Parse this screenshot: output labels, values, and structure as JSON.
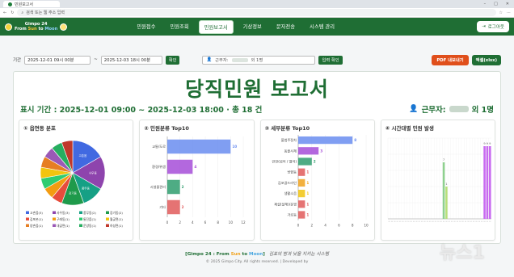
{
  "browser": {
    "tab_title": "민원보고서",
    "url_placeholder": "검색 또는 웹 주소 입력"
  },
  "app": {
    "logo_title": "Gimpo 24",
    "logo_sub_from": "From ",
    "logo_sub_sun": "Sun",
    "logo_sub_to": " to ",
    "logo_sub_moon": "Moon",
    "nav": [
      "민원접수",
      "민원조회",
      "민원보고서",
      "기상정보",
      "문자전송",
      "시스템 관리"
    ],
    "active_nav": 2,
    "logout": "로그아웃"
  },
  "filters": {
    "label": "기간",
    "start": "2025-12-01 09시 00분",
    "sep": "~",
    "end": "2025-12-03 18시 00분",
    "confirm": "확인",
    "worker_label": "근무자:",
    "worker_value": "외 1명",
    "worker_confirm": "입력 확인",
    "pdf": "PDF 내보내기",
    "excel": "엑셀(xlsx)"
  },
  "report": {
    "title": "당직민원 보고서",
    "period": "표시 기간 : 2025-12-01 09:00 ~ 2025-12-03 18:00 · 총 18 건",
    "worker_prefix": "근무자:",
    "worker_suffix": "외 1명"
  },
  "panels": {
    "p1": "① 읍면동 분포",
    "p2": "② 민원분류 Top10",
    "p3": "③ 세부분류 Top10",
    "p4": "④ 시간대별 민원 발생"
  },
  "chart_data": [
    {
      "type": "pie",
      "series_values": [
        3,
        3,
        2,
        2,
        1,
        1,
        1,
        1,
        1,
        1,
        1,
        1
      ],
      "colors": [
        "#4169e1",
        "#8e44ad",
        "#16a085",
        "#1f9a4b",
        "#e74c3c",
        "#f39c12",
        "#2ecc71",
        "#f1c40f",
        "#e67e22",
        "#9b59b6",
        "#27ae60",
        "#c0392b"
      ],
      "slice_labels": [
        "고촌읍",
        "사우동",
        "풍무동",
        "장기동",
        "",
        "",
        "",
        "",
        "",
        "",
        "",
        ""
      ],
      "legend": [
        "고촌읍(3)",
        "사우동(3)",
        "풍무동(2)",
        "장기동(2)",
        "김포본(1)",
        "구래동(1)",
        "통진읍(1)",
        "월곶면(1)",
        "양촌읍(1)",
        "대곶면(1)",
        "운양동(1)",
        "하성면(1)"
      ]
    },
    {
      "type": "bar",
      "orientation": "horizontal",
      "categories": [
        "교통/도로",
        "환경/위생",
        "시설물관리",
        "기타"
      ],
      "values": [
        10,
        4,
        2,
        2
      ],
      "colors": [
        "#6a8df0",
        "#a64dd8",
        "#2f9e6e",
        "#e05b5b"
      ],
      "xlim": [
        0,
        12
      ],
      "xticks": [
        0,
        2,
        4,
        6,
        8,
        10,
        12
      ]
    },
    {
      "type": "bar",
      "orientation": "horizontal",
      "categories": [
        "불법주정차",
        "동물사체",
        "안전(넘어 / 떨어)",
        "방향등",
        "김포골드라인",
        "생활소음",
        "제설(설해)/운영",
        "가로등"
      ],
      "values": [
        8,
        3,
        2,
        1,
        1,
        1,
        1,
        1
      ],
      "colors": [
        "#6a8df0",
        "#a64dd8",
        "#2f9e6e",
        "#e05b5b",
        "#f0a21c",
        "#f1c40f",
        "#e05b5b",
        "#e05b5b"
      ],
      "xlim": [
        0,
        10
      ],
      "xticks": [
        0,
        2,
        4,
        6,
        8,
        10
      ]
    },
    {
      "type": "bar",
      "categories_count": 38,
      "values": [
        0,
        0,
        0,
        0,
        0,
        0,
        0,
        0,
        0,
        0,
        0,
        0,
        0,
        0,
        0,
        0,
        0,
        0,
        0,
        0,
        7,
        4,
        0,
        0,
        0,
        0,
        0,
        0,
        0,
        0,
        0,
        0,
        0,
        0,
        0,
        9,
        9,
        9
      ],
      "labels": [
        "",
        "",
        "",
        "",
        "",
        "",
        "",
        "",
        "",
        "",
        "",
        "",
        "",
        "",
        "",
        "",
        "",
        "",
        "",
        "",
        "7",
        "1",
        "",
        "",
        "",
        "",
        "",
        "",
        "",
        "",
        "",
        "",
        "",
        "",
        "",
        "9",
        "9",
        "9"
      ],
      "colors": [
        "#8fd18f",
        "#b8e07a",
        "#c86bf0"
      ],
      "ylim": [
        0,
        10
      ]
    }
  ]
}
